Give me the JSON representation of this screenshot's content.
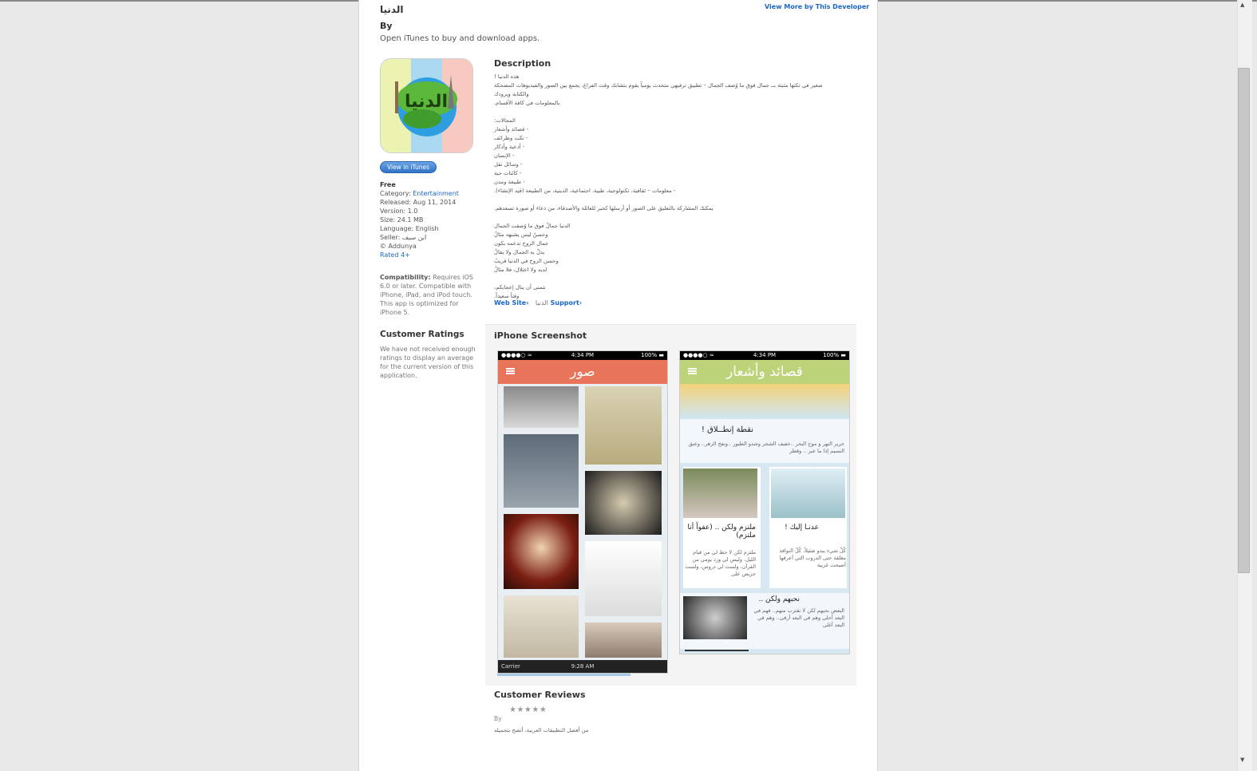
{
  "app": {
    "title": "الدنيا",
    "by_label": "By",
    "open_itunes": "Open iTunes to buy and download apps.",
    "view_more": "View More by This Developer",
    "itunes_button": "View in iTunes"
  },
  "info": {
    "price": "Free",
    "category_label": "Category: ",
    "category": "Entertainment",
    "released": "Released: Aug 11, 2014",
    "version": "Version: 1.0",
    "size": "Size: 24.1 MB",
    "language": "Language: English",
    "seller": "Seller: ابن سيف",
    "copyright": "© Addunya",
    "rated": "Rated 4+"
  },
  "compatibility": {
    "label": "Compatibility:",
    "text": " Requires iOS 6.0 or later. Compatible with iPhone, iPad, and iPod touch. This app is optimized for iPhone 5."
  },
  "ratings": {
    "title": "Customer Ratings",
    "text": "We have not received enough ratings to display an average for the current version of this application."
  },
  "description": {
    "title": "Description",
    "lines": [
      "هذه الدنيا !",
      "صغير في تكتها مثبتة بــ جمال فوق ما وُصف الجمال – تطبيق ترفيهي متحدث يومياً يقوم بتشابك وقت الفراغ، يجمع بين الصور والفيديوهات المضحكة والكتابة ويزودك",
      "بالمعلومات في كافة الأقسام.",
      "",
      "المجالات:",
      "- قصائد وأشعار",
      "- نكت وطرائف",
      "- أدعية وأذكار",
      "- الإنسان",
      "- وسائل نقل",
      "- كائنات حية",
      "- طبيعة ومدن",
      "- معلومات – ثقافية، تكنولوجية، طبية، اجتماعية، الدينية، من الطبيعة (قيد الإنشاء).",
      "",
      "يمكنك المشاركة بالتعليق على الصور أو أرسلها كخبر للعائلة والأصدقاء، من دعاء أو صورة تسعدهم.",
      "",
      "الدنيا جمالٌ فوق ما وُصفت الجمال",
      "وحسنٌ ليس يشبهه مثالُ",
      "جمال الروح تدعمه بكون",
      "يدلّ به الجمال ولا يقالُ",
      "وحسن الروح في الدنيا قريبٌ",
      "لديه ولا اعتلال، فلا مثالُ",
      "",
      "نتمنى أن ينال إعجابكم،",
      "وقتاً سعيداً."
    ]
  },
  "links": {
    "website": "Web Site",
    "website_arrow": "›",
    "developer_website": "الدنيا Web Site",
    "support_prefix": "الدنيا",
    "support": "Support",
    "support_arrow": "›"
  },
  "screenshots": {
    "title": "iPhone Screenshot",
    "shot1": {
      "status_time": "4:34 PM",
      "battery": "100%",
      "header": "صور",
      "carrier": "Carrier",
      "carrier_time": "9:28 AM"
    },
    "shot2": {
      "status_time": "4:34 PM",
      "battery": "100%",
      "header": "قصائد وأشعار",
      "articles": [
        {
          "title": "نقطة إنطــلاق !",
          "text": "خرير النهر و موج البحر ..حفيف الشجر وشدو الطيور ..ونفح الزهر.. وعبق النسيم إذا ما عبر .. وقطر"
        },
        {
          "title": "ملتزم ولكن .. (عفواً أنا ملتزم)",
          "text": "ملتزم لكن لا حظ لي من قيام الليل، وليس لي ورد يومي من القرآن، ولست لي دروس، ولست حريص على"
        },
        {
          "title": "عدنـا إليك !",
          "text": "كُلّ شيء يبدو ضئيلاً، كُلّ النوافذ مغلقة حتى الدروب التي أعرفها أصبحت غريبة"
        },
        {
          "title": "نحبهم ولكن ..",
          "text": "البعض نحبهم لكن لا نقترب منهم.. فهم في البعد أحلى وهم في البعد أرقى.. وهم في البعد أغلى"
        }
      ]
    }
  },
  "reviews": {
    "title": "Customer Reviews",
    "stars": "★★★★★",
    "by": "By",
    "text": "من أفضل التطبيقات العربية، أنصح بتحميله"
  },
  "colors": {
    "link": "#1b66c9",
    "header1": "#e8745a",
    "header2": "#bcd37a"
  }
}
